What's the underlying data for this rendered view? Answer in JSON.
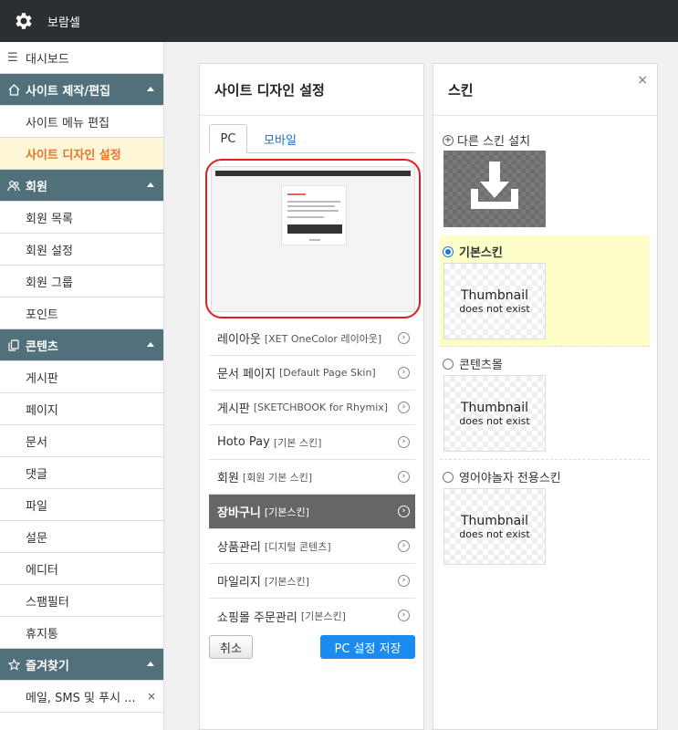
{
  "app": {
    "title": "보람셀"
  },
  "sidebar": {
    "dashboard": "대시보드",
    "groups": [
      {
        "label": "사이트 제작/편집",
        "items": [
          "사이트 메뉴 편집",
          "사이트 디자인 설정"
        ],
        "active_item": "사이트 디자인 설정"
      },
      {
        "label": "회원",
        "items": [
          "회원 목록",
          "회원 설정",
          "회원 그룹",
          "포인트"
        ]
      },
      {
        "label": "콘텐츠",
        "items": [
          "게시판",
          "페이지",
          "문서",
          "댓글",
          "파일",
          "설문",
          "에디터",
          "스팸필터",
          "휴지통"
        ]
      },
      {
        "label": "즐겨찾기",
        "items": [
          "메일, SMS 및 푸시 ..."
        ]
      }
    ]
  },
  "design_panel": {
    "title": "사이트 디자인 설정",
    "tabs": [
      "PC",
      "모바일"
    ],
    "active_tab": "PC",
    "menu": [
      {
        "label": "레이아웃",
        "sub": "[XET OneColor 레이아웃]"
      },
      {
        "label": "문서 페이지",
        "sub": "[Default Page Skin]"
      },
      {
        "label": "게시판",
        "sub": "[SKETCHBOOK for Rhymix]"
      },
      {
        "label": "Hoto Pay",
        "sub": "[기본 스킨]"
      },
      {
        "label": "회원",
        "sub": "[회원 기본 스킨]"
      },
      {
        "label": "장바구니",
        "sub": "[기본스킨]",
        "active": true
      },
      {
        "label": "상품관리",
        "sub": "[디지털 콘텐츠]"
      },
      {
        "label": "마일리지",
        "sub": "[기본스킨]"
      },
      {
        "label": "쇼핑몰 주문관리",
        "sub": "[기본스킨]"
      }
    ],
    "cancel_label": "취소",
    "save_label": "PC 설정 저장"
  },
  "skin_panel": {
    "title": "스킨",
    "close_label": "×",
    "install_label": "다른 스킨 설치",
    "skins": [
      {
        "name": "기본스킨",
        "selected": true,
        "thumb_title": "Thumbnail",
        "thumb_sub": "does not exist"
      },
      {
        "name": "콘텐츠몰",
        "selected": false,
        "thumb_title": "Thumbnail",
        "thumb_sub": "does not exist"
      },
      {
        "name": "영어야놀자 전용스킨",
        "selected": false,
        "thumb_title": "Thumbnail",
        "thumb_sub": "does not exist"
      }
    ]
  },
  "colors": {
    "topbar": "#2b2f33",
    "sidebar_head": "#52707b",
    "active_text": "#e8742b",
    "save_button": "#1a8cf0",
    "highlight_ring": "#e41b1b"
  }
}
